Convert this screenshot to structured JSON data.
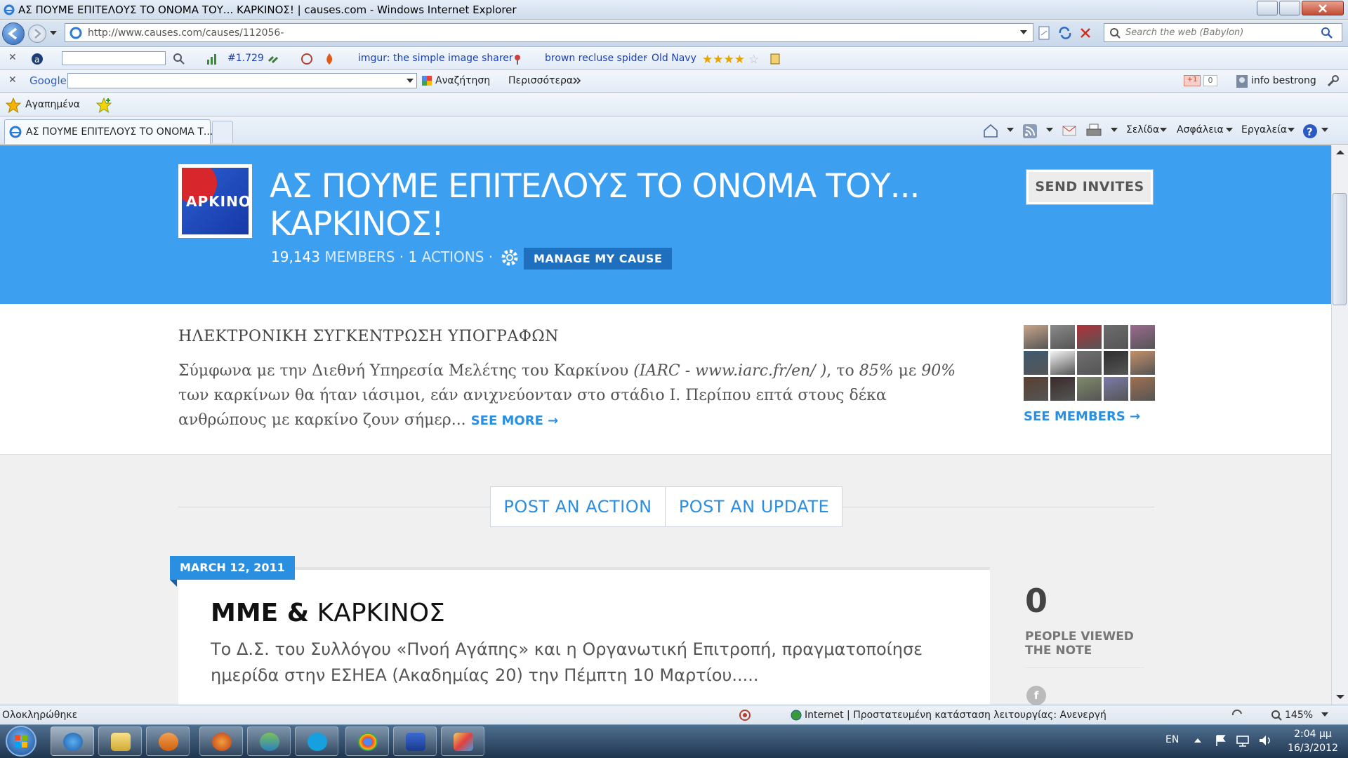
{
  "window": {
    "title": "ΑΣ ΠΟΥΜΕ ΕΠΙΤΕΛΟΥΣ ΤΟ ΟΝΟΜΑ ΤΟΥ... ΚΑΡΚΙΝΟΣ! | causes.com - Windows Internet Explorer"
  },
  "addressbar": {
    "url": "http://www.causes.com/causes/112056-",
    "search_placeholder": "Search the web (Babylon)"
  },
  "toolbar1": {
    "rank": "#1.729",
    "link1": "imgur: the simple image sharer",
    "link2": "brown recluse spider",
    "sep": "·",
    "link3": "Old Navy"
  },
  "toolbar2": {
    "google_label": "Google",
    "search_button": "Αναζήτηση",
    "more": "Περισσότερα",
    "gplus_count": "0",
    "user": "info bestrong"
  },
  "favorites": {
    "label": "Αγαπημένα"
  },
  "tabs": [
    {
      "label": "ΑΣ ΠΟΥΜΕ ΕΠΙΤΕΛΟΥΣ ΤΟ ΟΝΟΜΑ Τ..."
    }
  ],
  "commandbar": {
    "page": "Σελίδα",
    "safety": "Ασφάλεια",
    "tools": "Εργαλεία"
  },
  "cause": {
    "logo_text": "ΑΡΚΙΝΟ",
    "title": "ΑΣ ΠΟΥΜΕ ΕΠΙΤΕΛΟΥΣ ΤΟ ΟΝΟΜΑ ΤΟΥ... ΚΑΡΚΙΝΟΣ!",
    "members_count": "19,143",
    "members_label": "MEMBERS",
    "actions_count": "1",
    "actions_label": "ACTIONS",
    "manage_button": "MANAGE MY CAUSE",
    "send_invites": "SEND INVITES"
  },
  "description": {
    "heading": "ΗΛΕΚΤΡΟΝΙΚΗ ΣΥΓΚΕΝΤΡΩΣΗ ΥΠΟΓΡΑΦΩΝ",
    "text_a": "Σύμφωνα με την Διεθνή Υπηρεσία Μελέτης του Καρκίνου ",
    "text_b": "(IARC - www.iarc.fr/en/ )",
    "text_c": ", το ",
    "text_d": "85%",
    "text_e": " με ",
    "text_f": "90%",
    "text_g": " των καρκίνων θα ήταν ιάσιμοι, εάν ανιχνεύονταν στο στάδιο Ι. Περίπου επτά στους δέκα ανθρώπους με καρκίνο ζουν σήμερ...",
    "see_more": "SEE MORE →",
    "see_members": "SEE MEMBERS →"
  },
  "members_avatar_colors": [
    "#c9a58a",
    "#8a8a8a",
    "#b0313a",
    "#6c6c6c",
    "#9a6a8f",
    "#3f5a6f",
    "#f4f4f4",
    "#6f6f70",
    "#2e2e2e",
    "#c28f6a",
    "#5a4030",
    "#3a2a2a",
    "#7f8a6a",
    "#7b7ba9",
    "#a07050"
  ],
  "post_buttons": {
    "action": "POST AN ACTION",
    "update": "POST AN UPDATE"
  },
  "note": {
    "date": "MARCH 12, 2011",
    "title_bold": "ΜΜΕ &",
    "title_rest": " ΚΑΡΚΙΝΟΣ",
    "body": "Το Δ.Σ. του Συλλόγου «Πνοή Αγάπης» και η Οργανωτική Επιτροπή, πραγματοποίησε ημερίδα στην ΕΣΗΕΑ (Ακαδημίας 20) την Πέμπτη 10 Μαρτίου.....",
    "view_count": "0",
    "view_label": "PEOPLE VIEWED THE NOTE",
    "fb": "f"
  },
  "statusbar": {
    "left": "Ολοκληρώθηκε",
    "zone": "Internet | Προστατευμένη κατάσταση λειτουργίας: Ανενεργή",
    "zoom": "145%"
  },
  "taskbar": {
    "lang": "EN",
    "time": "2:04 μμ",
    "date": "16/3/2012"
  },
  "colors": {
    "hero": "#3d9ff0",
    "accent": "#2a8fe0",
    "manage": "#1f6fbf"
  }
}
